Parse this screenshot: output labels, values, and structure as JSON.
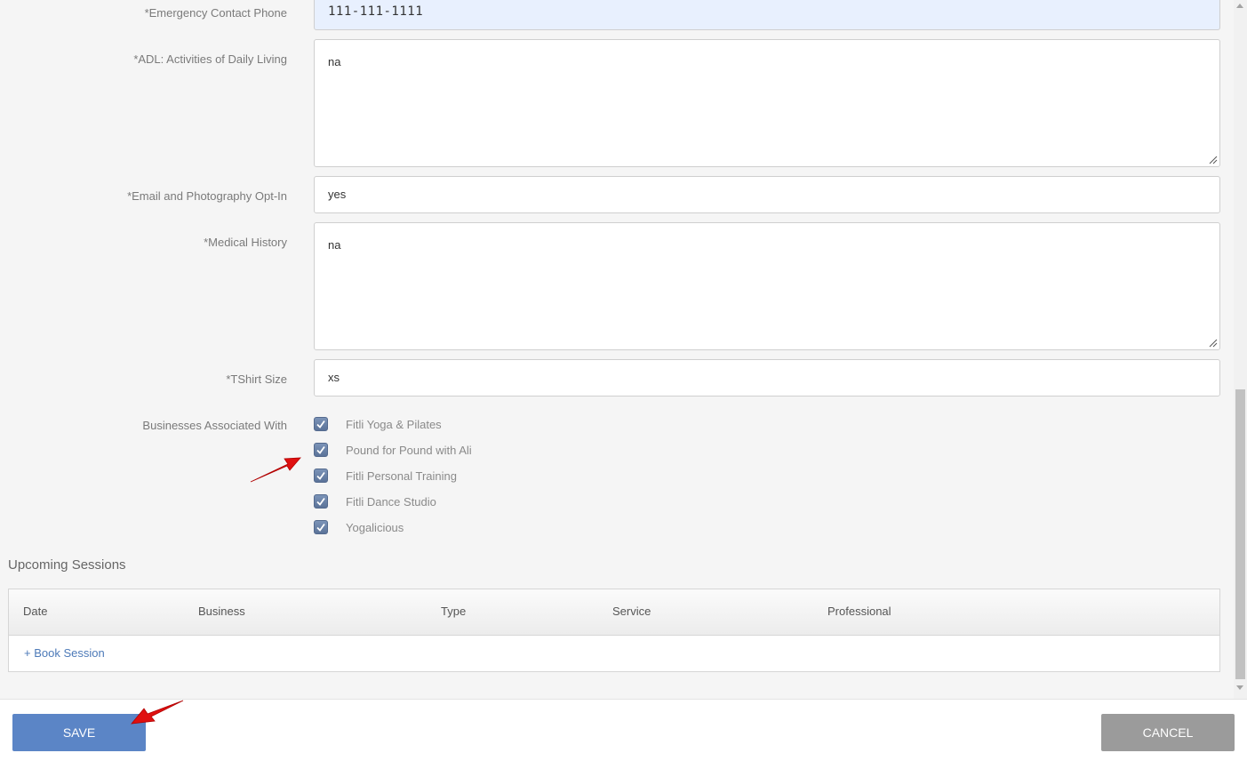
{
  "form": {
    "emergency_phone": {
      "label": "*Emergency Contact Phone",
      "value": "111-111-1111"
    },
    "adl": {
      "label": "*ADL: Activities of Daily Living",
      "value": "na"
    },
    "email_opt_in": {
      "label": "*Email and Photography Opt-In",
      "value": "yes"
    },
    "medical_history": {
      "label": "*Medical History",
      "value": "na"
    },
    "tshirt_size": {
      "label": "*TShirt Size",
      "value": "xs"
    },
    "businesses": {
      "label": "Businesses Associated With",
      "items": [
        {
          "label": "Fitli Yoga & Pilates",
          "checked": true
        },
        {
          "label": "Pound for Pound with Ali",
          "checked": true
        },
        {
          "label": "Fitli Personal Training",
          "checked": true
        },
        {
          "label": "Fitli Dance Studio",
          "checked": true
        },
        {
          "label": "Yogalicious",
          "checked": true
        }
      ]
    }
  },
  "sessions": {
    "title": "Upcoming Sessions",
    "columns": [
      "Date",
      "Business",
      "Type",
      "Service",
      "Professional"
    ],
    "book_link": "+ Book Session"
  },
  "footer": {
    "save_label": "SAVE",
    "cancel_label": "CANCEL"
  },
  "colors": {
    "save": "#5b85c6",
    "cancel": "#9b9b9b",
    "checkbox": "#6a82a8",
    "link": "#4d7ab8",
    "annotation_arrow": "#e01010"
  }
}
